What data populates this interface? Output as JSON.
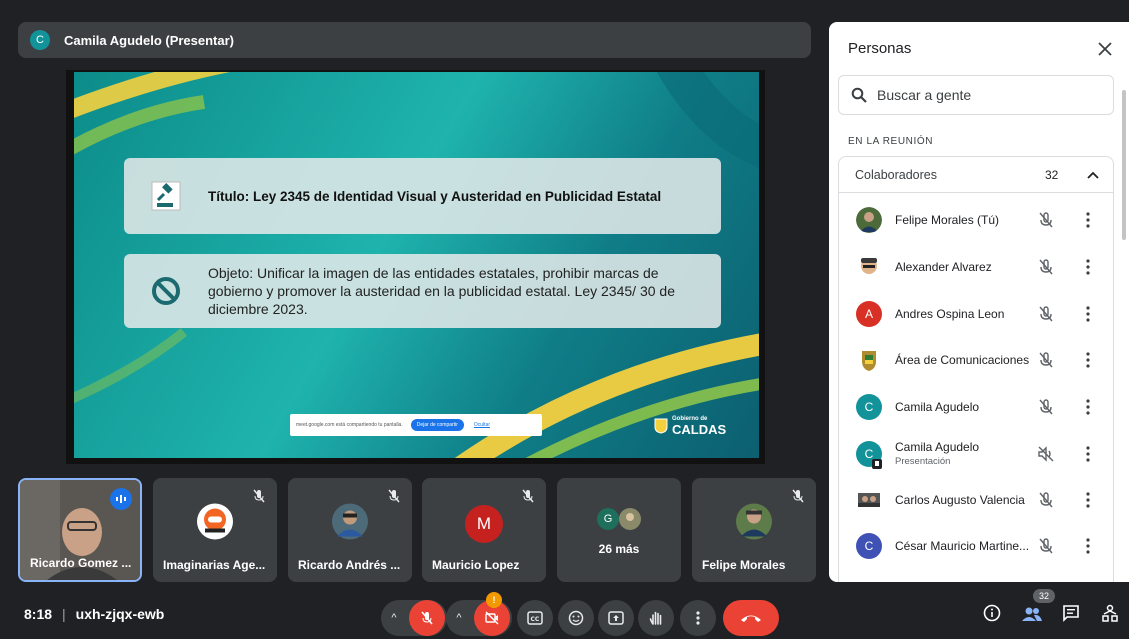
{
  "presenter": {
    "initial": "C",
    "name": "Camila Agudelo (Presentar)"
  },
  "slide": {
    "title": "Título: Ley 2345 de Identidad Visual y Austeridad en Publicidad Estatal",
    "body": "Objeto: Unificar la imagen de las entidades estatales, prohibir marcas de gobierno y promover la austeridad en la publicidad estatal. Ley 2345/ 30 de diciembre 2023.",
    "share_notice": "meet.google.com está compartiendo tu pantalla.",
    "share_stop": "Dejar de compartir",
    "share_hide": "Ocultar",
    "logo_small": "Gobierno de",
    "logo_big": "CALDAS"
  },
  "tiles": [
    {
      "name": "Ricardo Gomez ...",
      "type": "video"
    },
    {
      "name": "Imaginarias Age...",
      "type": "logo"
    },
    {
      "name": "Ricardo Andrés ...",
      "type": "photo"
    },
    {
      "name": "Mauricio Lopez",
      "type": "initial",
      "initial": "M",
      "color": "#c5221f"
    },
    {
      "name": "26 más",
      "type": "more",
      "initial": "G"
    },
    {
      "name": "Felipe Morales",
      "type": "photo"
    }
  ],
  "meeting": {
    "time": "8:18",
    "separator": "|",
    "code": "uxh-zjqx-ewb"
  },
  "controls": {
    "notification_badge": "!",
    "people_count": "32"
  },
  "panel": {
    "title": "Personas",
    "search_placeholder": "Buscar a gente",
    "section": "EN LA REUNIÓN",
    "group_label": "Colaboradores",
    "group_count": "32",
    "people": [
      {
        "name": "Felipe Morales (Tú)",
        "avatar": "photo",
        "color": "#2a5f2a"
      },
      {
        "name": "Alexander Alvarez",
        "avatar": "cartoon",
        "color": "#7a4a2a"
      },
      {
        "name": "Andres Ospina Leon",
        "avatar": "initial",
        "initial": "A",
        "color": "#d93025"
      },
      {
        "name": "Área de Comunicaciones",
        "avatar": "shield",
        "color": "#b08a2e"
      },
      {
        "name": "Camila Agudelo",
        "avatar": "initial",
        "initial": "C",
        "color": "#12939a"
      },
      {
        "name": "Camila Agudelo",
        "sub": "Presentación",
        "avatar": "initial",
        "initial": "C",
        "color": "#12939a"
      },
      {
        "name": "Carlos Augusto Valencia",
        "avatar": "photo",
        "color": "#555"
      },
      {
        "name": "César Mauricio Martine...",
        "avatar": "initial",
        "initial": "C",
        "color": "#3f51b5"
      }
    ]
  },
  "colors": {
    "accent": "#1a73e8",
    "danger": "#ea4335",
    "bg": "#202124",
    "tile": "#3c4043"
  }
}
